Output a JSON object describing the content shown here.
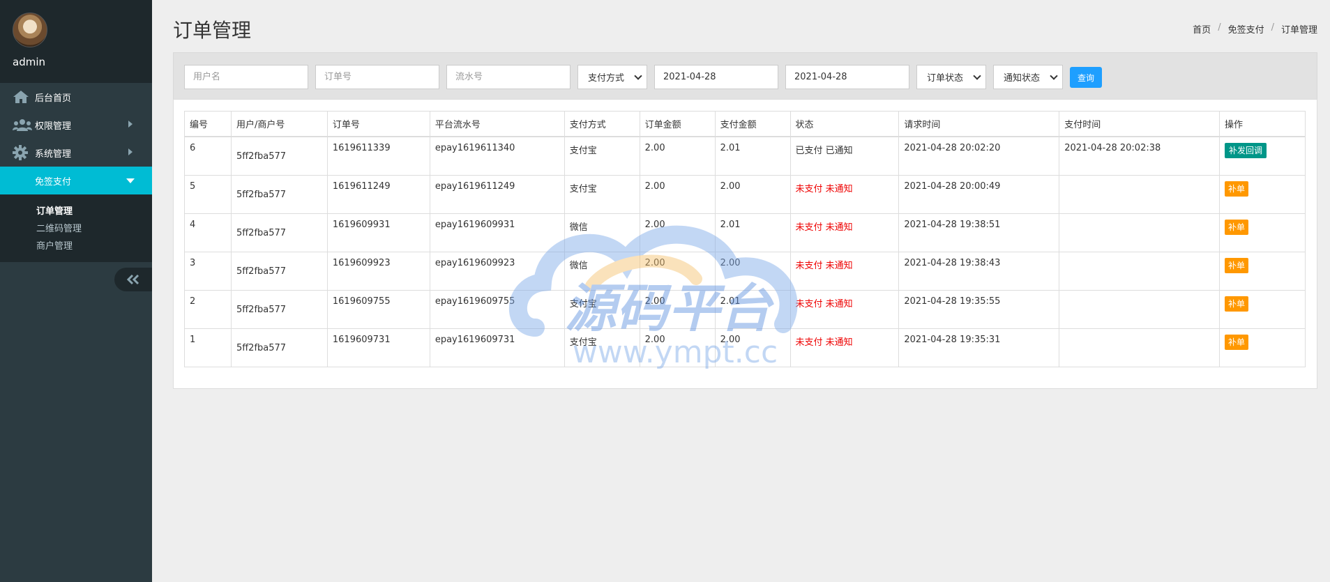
{
  "sidebar": {
    "user_name": "admin",
    "items": [
      {
        "label": "后台首页",
        "icon": "home-icon"
      },
      {
        "label": "权限管理",
        "icon": "users-icon"
      },
      {
        "label": "系统管理",
        "icon": "gear-icon"
      },
      {
        "label": "免签支付",
        "icon": "chevron-down-icon"
      }
    ],
    "submenu": [
      "订单管理",
      "二维码管理",
      "商户管理"
    ],
    "active_color": "#00bcd4"
  },
  "header": {
    "title": "订单管理",
    "breadcrumb": [
      "首页",
      "免签支付",
      "订单管理"
    ]
  },
  "filters": {
    "username_placeholder": "用户名",
    "order_no_placeholder": "订单号",
    "serial_no_placeholder": "流水号",
    "pay_method": "支付方式",
    "date_start": "2021-04-28",
    "date_end": "2021-04-28",
    "order_status": "订单状态",
    "notify_status": "通知状态",
    "query_label": "查询"
  },
  "table": {
    "columns": [
      "编号",
      "用户/商户号",
      "订单号",
      "平台流水号",
      "支付方式",
      "订单金额",
      "支付金额",
      "状态",
      "请求时间",
      "支付时间",
      "操作"
    ],
    "rows": [
      {
        "id": "6",
        "merchant": "5ff2fba577",
        "order_no": "1619611339",
        "serial": "epay1619611340",
        "method": "支付宝",
        "order_amount": "2.00",
        "pay_amount": "2.01",
        "status": "已支付 已通知",
        "status_paid": true,
        "request_time": "2021-04-28 20:02:20",
        "pay_time": "2021-04-28 20:02:38",
        "action": "补发回调"
      },
      {
        "id": "5",
        "merchant": "5ff2fba577",
        "order_no": "1619611249",
        "serial": "epay1619611249",
        "method": "支付宝",
        "order_amount": "2.00",
        "pay_amount": "2.00",
        "status": "未支付 未通知",
        "status_paid": false,
        "request_time": "2021-04-28 20:00:49",
        "pay_time": "",
        "action": "补单"
      },
      {
        "id": "4",
        "merchant": "5ff2fba577",
        "order_no": "1619609931",
        "serial": "epay1619609931",
        "method": "微信",
        "order_amount": "2.00",
        "pay_amount": "2.01",
        "status": "未支付 未通知",
        "status_paid": false,
        "request_time": "2021-04-28 19:38:51",
        "pay_time": "",
        "action": "补单"
      },
      {
        "id": "3",
        "merchant": "5ff2fba577",
        "order_no": "1619609923",
        "serial": "epay1619609923",
        "method": "微信",
        "order_amount": "2.00",
        "pay_amount": "2.00",
        "status": "未支付 未通知",
        "status_paid": false,
        "request_time": "2021-04-28 19:38:43",
        "pay_time": "",
        "action": "补单"
      },
      {
        "id": "2",
        "merchant": "5ff2fba577",
        "order_no": "1619609755",
        "serial": "epay1619609755",
        "method": "支付宝",
        "order_amount": "2.00",
        "pay_amount": "2.01",
        "status": "未支付 未通知",
        "status_paid": false,
        "request_time": "2021-04-28 19:35:55",
        "pay_time": "",
        "action": "补单"
      },
      {
        "id": "1",
        "merchant": "5ff2fba577",
        "order_no": "1619609731",
        "serial": "epay1619609731",
        "method": "支付宝",
        "order_amount": "2.00",
        "pay_amount": "2.00",
        "status": "未支付 未通知",
        "status_paid": false,
        "request_time": "2021-04-28 19:35:31",
        "pay_time": "",
        "action": "补单"
      }
    ]
  },
  "watermark": {
    "brand": "源码平台",
    "url": "www.ympt.cc"
  }
}
